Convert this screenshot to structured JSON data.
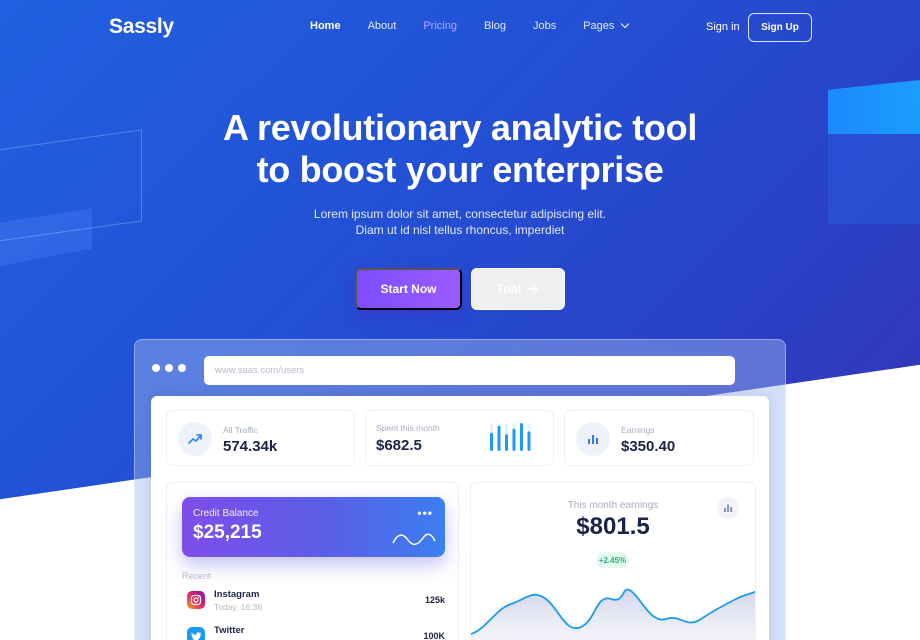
{
  "colors": {
    "primary_gradient": [
      "#2160e0",
      "#3b2fb0"
    ],
    "accent_purple": "#7c4dff",
    "pricing_link": "#b9a3ff",
    "text_dark": "#1b2447",
    "muted": "#a6adbd",
    "positive": "#22b573",
    "chart_line": "#1d9bf0"
  },
  "nav": {
    "logo": "Sassly",
    "links": [
      "Home",
      "About",
      "Pricing",
      "Blog",
      "Jobs"
    ],
    "pages_label": "Pages",
    "pages_icon": "chevron-down-icon",
    "signin": "Sign in",
    "signup": "Sign Up"
  },
  "hero": {
    "title_line1": "A revolutionary analytic tool",
    "title_line2": "to boost your enterprise",
    "subtitle_line1": "Lorem ipsum dolor sit amet, consectetur adipiscing elit.",
    "subtitle_line2": "Diam ut id nisl tellus rhoncus, imperdiet",
    "start_button": "Start Now",
    "trial_button": "Trial",
    "trial_icon": "arrow-right-icon"
  },
  "browser": {
    "url": "www.saas.com/users"
  },
  "dashboard": {
    "stats": [
      {
        "label": "All Traffic",
        "value": "574.34k",
        "icon": "trending-up-icon"
      },
      {
        "label": "Spent this month",
        "value": "$682.5",
        "icon": "bar-chart-icon",
        "bars": [
          0.65,
          0.9,
          0.6,
          0.8,
          1.0,
          0.7
        ]
      },
      {
        "label": "Earnings",
        "value": "$350.40",
        "icon": "bar-chart-icon"
      }
    ],
    "credit": {
      "label": "Credit Balance",
      "value": "$25,215",
      "more_icon": "more-horizontal-icon"
    },
    "recent_label": "Recent",
    "recent": [
      {
        "name": "Instagram",
        "time": "Today, 16:36",
        "value": "125k",
        "icon": "instagram-icon"
      },
      {
        "name": "Twitter",
        "time": "",
        "value": "100K",
        "icon": "twitter-icon"
      }
    ],
    "earnings": {
      "label": "This month earnings",
      "value": "$801.5",
      "change": "+2.45%",
      "icon": "bar-chart-icon"
    }
  }
}
